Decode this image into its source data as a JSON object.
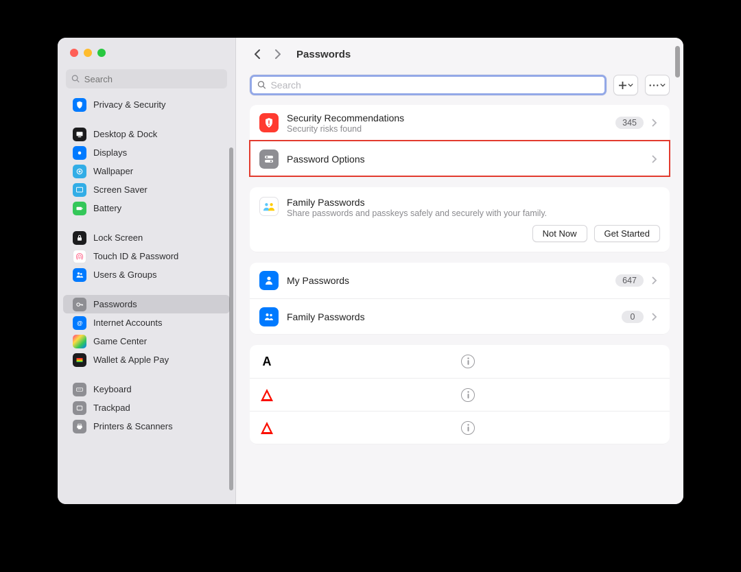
{
  "header": {
    "title": "Passwords"
  },
  "sidebar": {
    "search_placeholder": "Search",
    "items": {
      "privacy": "Privacy & Security",
      "desktop": "Desktop & Dock",
      "displays": "Displays",
      "wallpaper": "Wallpaper",
      "screensaver": "Screen Saver",
      "battery": "Battery",
      "lockscreen": "Lock Screen",
      "touchid": "Touch ID & Password",
      "users": "Users & Groups",
      "passwords": "Passwords",
      "internet": "Internet Accounts",
      "gamecenter": "Game Center",
      "wallet": "Wallet & Apple Pay",
      "keyboard": "Keyboard",
      "trackpad": "Trackpad",
      "printers": "Printers & Scanners"
    }
  },
  "main": {
    "search_placeholder": "Search",
    "security": {
      "title": "Security Recommendations",
      "subtitle": "Security risks found",
      "count": "345"
    },
    "options": {
      "title": "Password Options"
    },
    "family": {
      "title": "Family Passwords",
      "subtitle": "Share passwords and passkeys safely and securely with your family.",
      "not_now": "Not Now",
      "get_started": "Get Started"
    },
    "my_passwords": {
      "title": "My Passwords",
      "count": "647"
    },
    "family_passwords": {
      "title": "Family Passwords",
      "count": "0"
    }
  }
}
